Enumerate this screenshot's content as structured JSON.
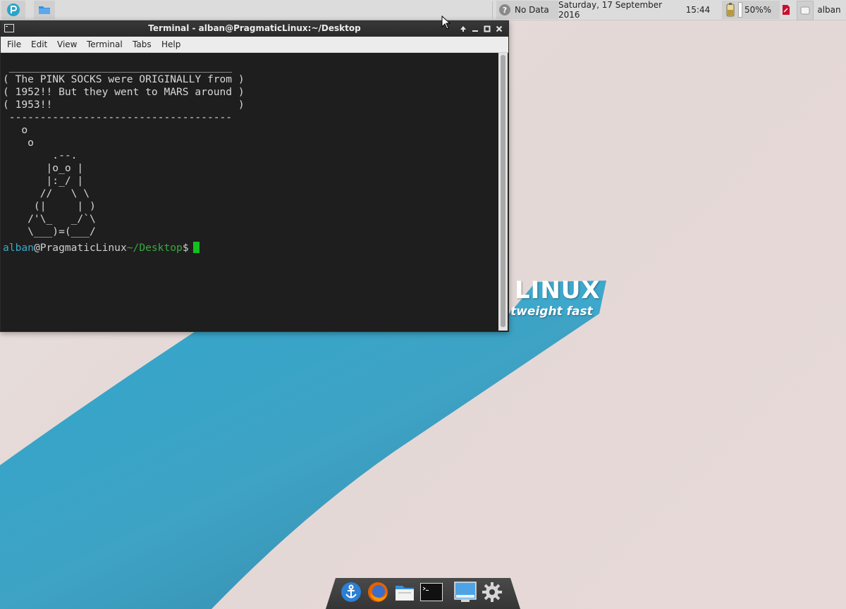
{
  "top_panel": {
    "weather_label": "No Data",
    "date": "Saturday, 17 September 2016",
    "time": "15:44",
    "battery_label": "50%%",
    "user_label": "alban"
  },
  "wallpaper": {
    "logo_word": "LINUX",
    "logo_tagline": "ntweight  fast"
  },
  "terminal": {
    "title": "Terminal - alban@PragmaticLinux:~/Desktop",
    "menu": {
      "file": "File",
      "edit": "Edit",
      "view": "View",
      "terminal": "Terminal",
      "tabs": "Tabs",
      "help": "Help"
    },
    "output": " ____________________________________\n( The PINK SOCKS were ORIGINALLY from )\n( 1952!! But they went to MARS around )\n( 1953!!                              )\n ------------------------------------\n   o\n    o\n        .--.\n       |o_o |\n       |:_/ |\n      //   \\ \\\n     (|     | )\n    /'\\_   _/`\\\n    \\___)=(___/",
    "prompt": {
      "user": "alban",
      "at": "@",
      "host": "PragmaticLinux",
      "path": "~/Desktop",
      "dollar": "$"
    }
  },
  "colors": {
    "panel_bg": "#dcdcdc",
    "terminal_bg": "#1e1e1e",
    "prompt_user": "#39a9c9",
    "prompt_path": "#3aa940",
    "cursor": "#14c01e",
    "wallpaper_swoosh": "#2fa1c6"
  },
  "icons": {
    "app_menu": "pragmatic-logo-icon",
    "file_manager": "folder-icon",
    "weather": "help-icon",
    "battery": "battery-icon",
    "notes": "notes-icon",
    "window_list": "window-list-icon",
    "dock": [
      "anchor-icon",
      "firefox-icon",
      "files-icon",
      "terminal-icon",
      "display-icon",
      "gear-icon"
    ]
  }
}
